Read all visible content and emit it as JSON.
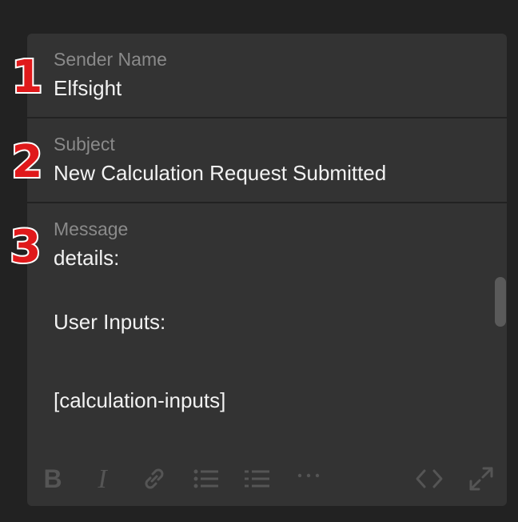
{
  "fields": {
    "sender": {
      "label": "Sender Name",
      "value": "Elfsight"
    },
    "subject": {
      "label": "Subject",
      "value": "New Calculation Request Submitted"
    },
    "message": {
      "label": "Message",
      "lines": [
        "details:",
        "User Inputs:",
        "[calculation-inputs]"
      ]
    }
  },
  "badges": [
    "1",
    "2",
    "3"
  ],
  "toolbar": {
    "icons": [
      "bold-icon",
      "italic-icon",
      "link-icon",
      "bulleted-list-icon",
      "numbered-list-icon",
      "more-icon",
      "code-icon",
      "fullscreen-icon"
    ]
  },
  "colors": {
    "background": "#222222",
    "panel": "#333333",
    "label": "#8a8a8a",
    "text": "#f2f2f2",
    "badge_fill": "#e0191b",
    "toolbar_icon": "#555555"
  }
}
